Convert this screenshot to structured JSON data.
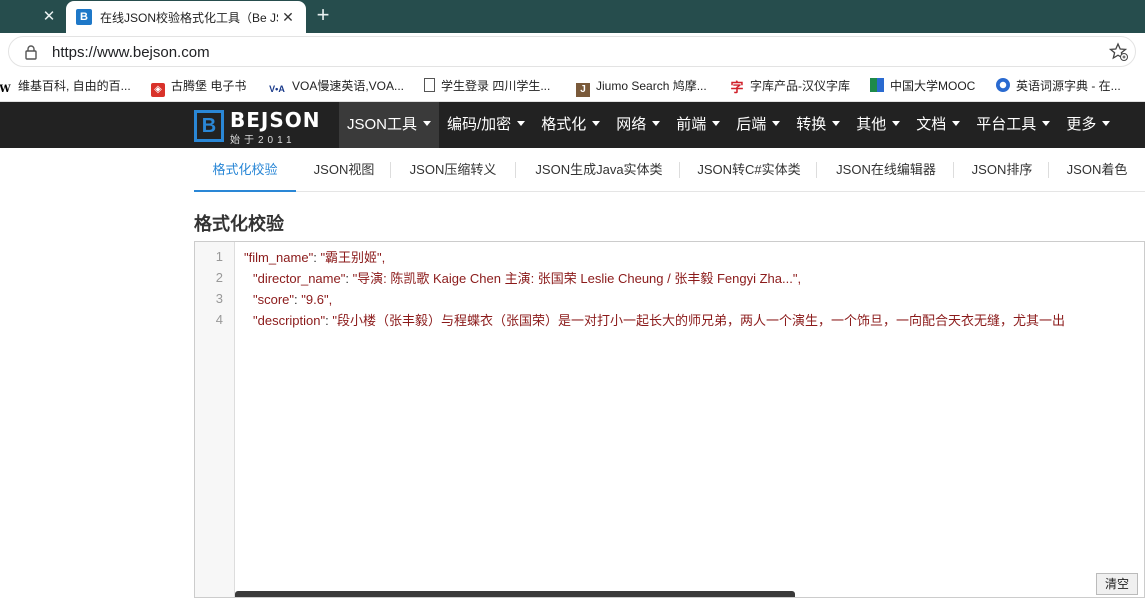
{
  "browser": {
    "tab_title": "在线JSON校验格式化工具（Be JSON）",
    "url": "https://www.bejson.com",
    "bookmarks": [
      "维基百科, 自由的百...",
      "古腾堡 电子书",
      "VOA慢速英语,VOA...",
      "学生登录 四川学生...",
      "Jiumo Search 鸠摩...",
      "字库产品-汉仪字库",
      "中国大学MOOC",
      "英语词源字典 - 在..."
    ]
  },
  "site": {
    "logo_text": "BEJSON",
    "logo_sub": "始于2011",
    "menu": [
      "JSON工具",
      "编码/加密",
      "格式化",
      "网络",
      "前端",
      "后端",
      "转换",
      "其他",
      "文档",
      "平台工具",
      "更多"
    ],
    "subtabs": [
      "格式化校验",
      "JSON视图",
      "JSON压缩转义",
      "JSON生成Java实体类",
      "JSON转C#实体类",
      "JSON在线编辑器",
      "JSON排序",
      "JSON着色"
    ],
    "heading": "格式化校验"
  },
  "editor": {
    "line_numbers": [
      "1",
      "2",
      "3",
      "4"
    ],
    "lines": [
      {
        "key": "\"film_name\"",
        "value": "\"霸王别姬\","
      },
      {
        "key": "\"director_name\"",
        "value": "\"导演: 陈凯歌 Kaige Chen   主演: 张国荣 Leslie Cheung / 张丰毅 Fengyi Zha...\","
      },
      {
        "key": "\"score\"",
        "value": "\"9.6\","
      },
      {
        "key": "\"description\"",
        "value": "\"段小楼（张丰毅）与程蝶衣（张国荣）是一对打小一起长大的师兄弟，两人一个演生，一个饰旦，一向配合天衣无缝，尤其一出"
      }
    ],
    "clear_label": "清空"
  }
}
